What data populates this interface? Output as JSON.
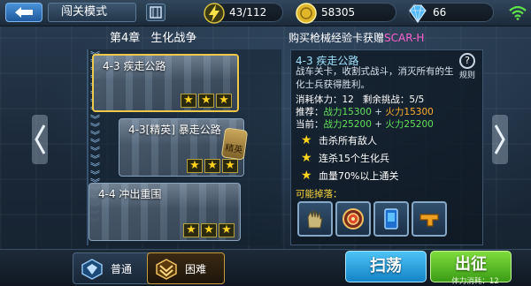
{
  "header": {
    "mode_title": "闯关模式",
    "stamina": "43/112",
    "gold": "58305",
    "gems": "66"
  },
  "chapter": {
    "number": "第4章",
    "name": "生化战争"
  },
  "promo": {
    "prefix": "购买枪械经验卡获赠",
    "highlight": "SCAR-H"
  },
  "levels": [
    {
      "label": "4-3 疾走公路",
      "stars": [
        "★",
        "★",
        "★"
      ]
    },
    {
      "label": "4-3[精英] 暴走公路",
      "stars": [
        "★",
        "★",
        "★"
      ],
      "badge": "精英"
    },
    {
      "label": "4-4 冲出重围",
      "stars": [
        "★",
        "★",
        "★"
      ]
    }
  ],
  "detail": {
    "title": "4-3 疾走公路",
    "help_label": "规则",
    "description": "战车关卡，收割式战斗，消灭所有的生化士兵获得胜利。",
    "cost_label": "消耗体力：",
    "cost_value": "12",
    "remaining_label": "剩余挑战：",
    "remaining_value": "5/5",
    "rec_label": "推荐：",
    "rec_power": "战力15300",
    "rec_fire": "火力15300",
    "cur_label": "当前：",
    "cur_power": "战力25200",
    "cur_fire": "火力25200",
    "plus": "+",
    "objectives": [
      "击杀所有敌人",
      "连杀15个生化兵",
      "血量70%以上通关"
    ],
    "drops_label": "可能掉落："
  },
  "tabs": {
    "normal": "普通",
    "hard": "困难"
  },
  "buttons": {
    "sweep": "扫荡",
    "start": "出征",
    "cost_note": "体力消耗：12"
  },
  "colors": {
    "accent_blue": "#1583c7",
    "accent_green": "#3a9c16",
    "power_green": "#63e35a",
    "fire_orange": "#ffae2e",
    "star_gold": "#ffd21e",
    "promo_pink": "#ff5fd0"
  },
  "icons": {
    "back": "back-arrow-icon",
    "map": "map-icon",
    "stamina": "lightning-icon",
    "gold": "coin-icon",
    "gem": "diamond-icon",
    "wifi": "wifi-icon",
    "help": "help-icon",
    "star": "star-icon",
    "drops": [
      "glove-icon",
      "target-badge-icon",
      "card-icon",
      "weapon-part-icon"
    ]
  }
}
